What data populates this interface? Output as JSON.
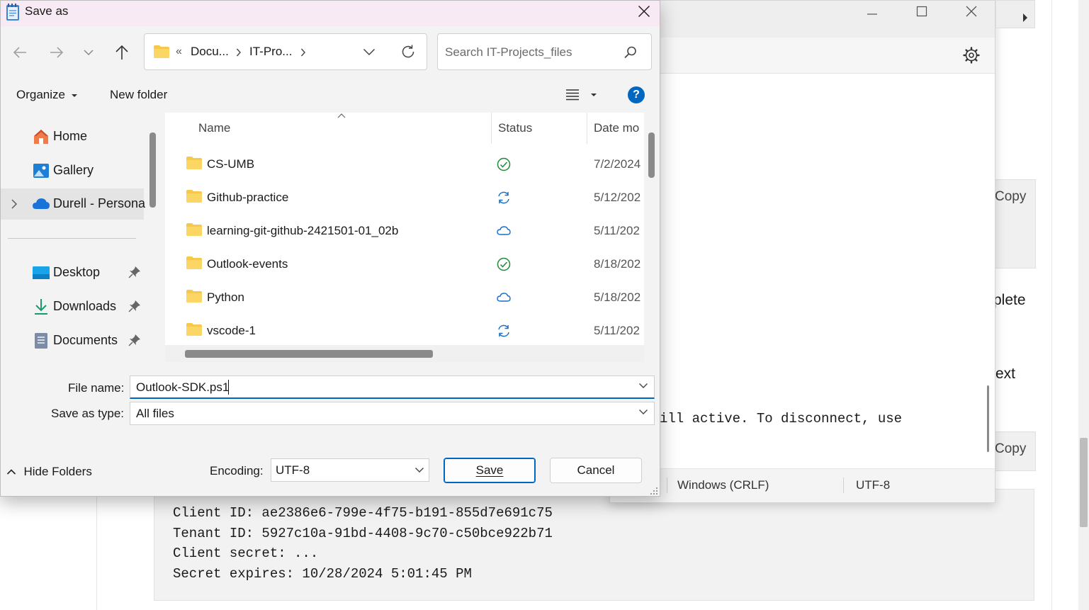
{
  "background_page": {
    "copy_label_1": "Copy",
    "copy_label_2": "Copy",
    "fragment_delete": "plete",
    "fragment_next": "ext",
    "code_fragment": "ill active. To disconnect, use",
    "code_lines": [
      "Client ID: ae2386e6-799e-4f75-b191-855d7e691c75",
      "Tenant ID: 5927c10a-91bd-4408-9c70-c50bce922b71",
      "Client secret: ...",
      "Secret expires: 10/28/2024 5:01:45 PM"
    ]
  },
  "notepad": {
    "status_line_ending": "Windows (CRLF)",
    "status_encoding": "UTF-8"
  },
  "dialog": {
    "title": "Save as",
    "address": {
      "overflow": "«",
      "crumbs": [
        "Docu...",
        "IT-Pro..."
      ]
    },
    "search_placeholder": "Search IT-Projects_files",
    "organize_label": "Organize",
    "new_folder_label": "New folder",
    "help_label": "?",
    "nav": {
      "home": "Home",
      "gallery": "Gallery",
      "onedrive": "Durell - Personal",
      "desktop": "Desktop",
      "downloads": "Downloads",
      "documents": "Documents"
    },
    "columns": {
      "name": "Name",
      "status": "Status",
      "date": "Date mo"
    },
    "files": [
      {
        "name": "CS-UMB",
        "status": "synced",
        "date": "7/2/2024"
      },
      {
        "name": "Github-practice",
        "status": "syncing",
        "date": "5/12/202"
      },
      {
        "name": "learning-git-github-2421501-01_02b",
        "status": "cloud",
        "date": "5/11/202"
      },
      {
        "name": "Outlook-events",
        "status": "synced",
        "date": "8/18/202"
      },
      {
        "name": "Python",
        "status": "cloud",
        "date": "5/18/202"
      },
      {
        "name": "vscode-1",
        "status": "syncing",
        "date": "5/11/202"
      }
    ],
    "file_name_label": "File name:",
    "file_name_value": "Outlook-SDK.ps1",
    "save_type_label": "Save as type:",
    "save_type_value": "All files",
    "hide_folders_label": "Hide Folders",
    "encoding_label": "Encoding:",
    "encoding_value": "UTF-8",
    "save_label": "Save",
    "cancel_label": "Cancel"
  },
  "colors": {
    "accent": "#0067c0",
    "folder": "#f8c84a",
    "dialog_title_bg": "#f7eaf4",
    "status_icon": "#1a6fc4",
    "synced": "#1e8a3a"
  }
}
